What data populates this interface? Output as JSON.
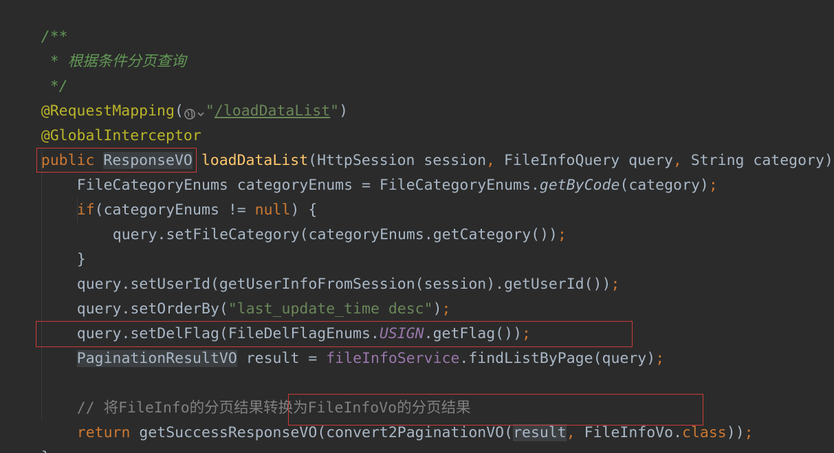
{
  "doc_comment": {
    "open": "/**",
    "text": " * 根据条件分页查询",
    "close": " */"
  },
  "request_mapping": {
    "annotation": "@RequestMapping",
    "open": "(",
    "quote_open": "\"",
    "path": "/loadDataList",
    "quote_close": "\"",
    "close": ")"
  },
  "global_interceptor": "@GlobalInterceptor",
  "signature": {
    "modifier": "public",
    "return_type": "ResponseVO",
    "method_name": "loadDataList",
    "params_part1": "(HttpSession session",
    "comma1": ",",
    "params_part2": " FileInfoQuery query",
    "comma2": ",",
    "params_part3": " String category){"
  },
  "line_enum": {
    "type": "FileCategoryEnums",
    "rest_a": " categoryEnums = FileCategoryEnums.",
    "call": "getByCode",
    "rest_b": "(category)",
    "semi": ";"
  },
  "line_if": {
    "kw": "if",
    "part1": "(categoryEnums != ",
    "null": "null",
    "part2": ") {"
  },
  "line_set_category": {
    "code": "query.setFileCategory(categoryEnums.getCategory())",
    "semi": ";"
  },
  "line_close_if": "}",
  "line_set_user": {
    "code": "query.setUserId(getUserInfoFromSession(session).getUserId())",
    "semi": ";"
  },
  "line_order": {
    "code_a": "query.setOrderBy(",
    "str": "\"last_update_time desc\"",
    "code_b": ")",
    "semi": ";"
  },
  "line_del_flag": {
    "code_a": "query.setDelFlag(FileDelFlagEnums.",
    "const": "USIGN",
    "code_b": ".getFlag())",
    "semi": ";"
  },
  "line_result": {
    "type": "PaginationResultVO",
    "code_a": " result = ",
    "field": "fileInfoService",
    "code_b": ".findListByPage(query)",
    "semi": ";"
  },
  "line_comment": "// 将FileInfo的分页结果转换为FileInfoVo的分页结果",
  "line_return": {
    "kw": "return",
    "code_a": " getSuccessResponseVO(",
    "code_b": "convert2PaginationVO(",
    "var": "result",
    "comma": ",",
    "code_c": " FileInfoVo.",
    "class_kw": "class",
    "code_d": "))",
    "semi": ";"
  },
  "closing_brace": "}",
  "colors": {
    "background": "#2b2b2b",
    "default_text": "#a9b7c6",
    "keyword": "#cc7832",
    "annotation": "#bbb529",
    "string": "#6a8759",
    "method_decl": "#ffc66d",
    "field": "#9876aa",
    "doc_comment": "#629755",
    "line_comment": "#808080",
    "highlight_box": "#d13a3a"
  },
  "icons": {
    "request_mapping_gutter": "globe-icon"
  }
}
